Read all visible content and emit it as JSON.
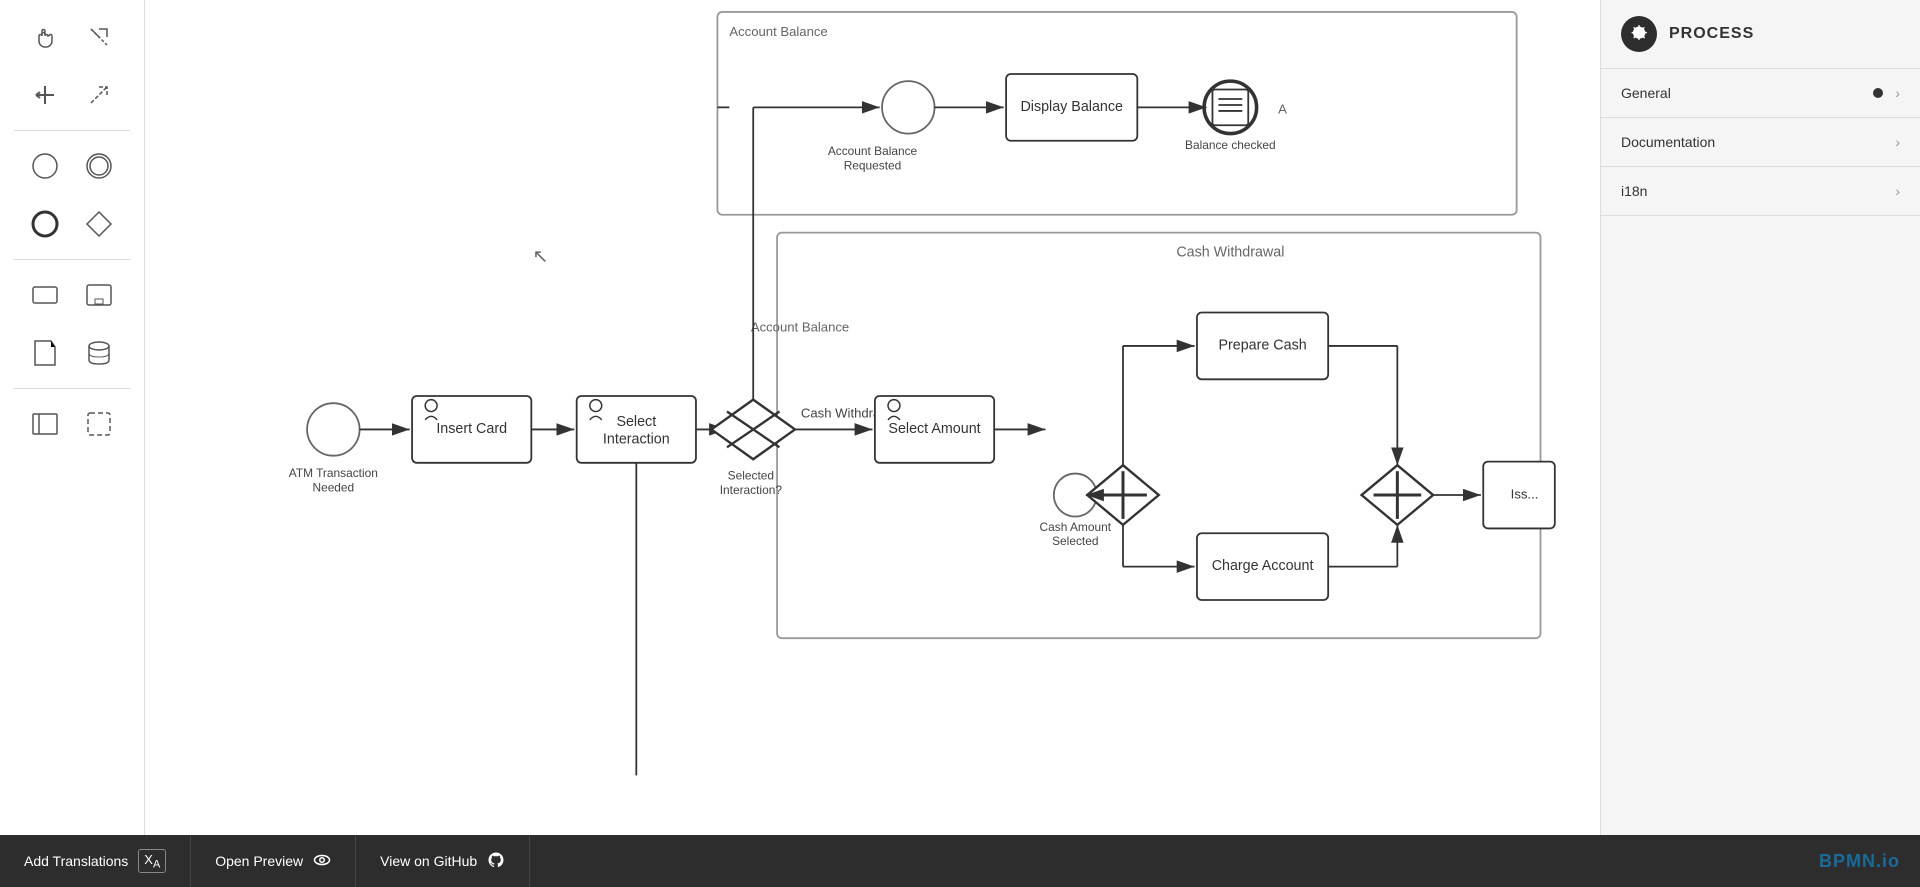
{
  "toolbar": {
    "tools": [
      {
        "name": "hand-tool",
        "icon": "✋",
        "label": "Hand Tool"
      },
      {
        "name": "lasso-tool",
        "icon": "⊹",
        "label": "Lasso Tool"
      },
      {
        "name": "connect-tool",
        "icon": "⟺",
        "label": "Connect Tool"
      },
      {
        "name": "arrow-tool",
        "icon": "↗",
        "label": "Arrow Tool"
      },
      {
        "name": "start-event",
        "icon": "○",
        "label": "Start Event"
      },
      {
        "name": "intermediate-event",
        "icon": "◎",
        "label": "Intermediate Event"
      },
      {
        "name": "end-event",
        "icon": "●",
        "label": "End Event"
      },
      {
        "name": "gateway",
        "icon": "◇",
        "label": "Gateway"
      },
      {
        "name": "task",
        "icon": "□",
        "label": "Task"
      },
      {
        "name": "subprocess",
        "icon": "▣",
        "label": "Sub Process"
      },
      {
        "name": "data-object",
        "icon": "📄",
        "label": "Data Object"
      },
      {
        "name": "data-store",
        "icon": "🗄",
        "label": "Data Store"
      },
      {
        "name": "pool",
        "icon": "▭",
        "label": "Pool"
      },
      {
        "name": "group",
        "icon": "⬚",
        "label": "Group"
      }
    ]
  },
  "right_panel": {
    "title": "PROCESS",
    "items": [
      {
        "label": "General",
        "has_dot": true,
        "has_chevron": true
      },
      {
        "label": "Documentation",
        "has_dot": false,
        "has_chevron": true
      },
      {
        "label": "i18n",
        "has_dot": false,
        "has_chevron": true
      }
    ]
  },
  "bottom_bar": {
    "buttons": [
      {
        "label": "Add Translations",
        "icon": "Xₐ"
      },
      {
        "label": "Open Preview",
        "icon": "👁"
      },
      {
        "label": "View on GitHub",
        "icon": "⊙"
      }
    ],
    "logo": "BPMN.io"
  },
  "diagram": {
    "nodes": {
      "atm_transaction": "ATM Transaction\nNeeded",
      "insert_card": "Insert Card",
      "select_interaction": "Select\nInteraction",
      "selected_interaction": "Selected\nInteraction?",
      "account_balance": "Account Balance",
      "cash_withdrawal": "Cash Withdrawal",
      "account_balance_requested": "Account Balance\nRequested",
      "display_balance": "Display Balance",
      "balance_checked": "Balance checked",
      "select_amount": "Select Amount",
      "cash_withdrawal_label": "Cash Withdrawal",
      "prepare_cash": "Prepare Cash",
      "cash_amount_selected": "Cash Amount\nSelected",
      "charge_account": "Charge Account",
      "issue": "Iss..."
    }
  }
}
